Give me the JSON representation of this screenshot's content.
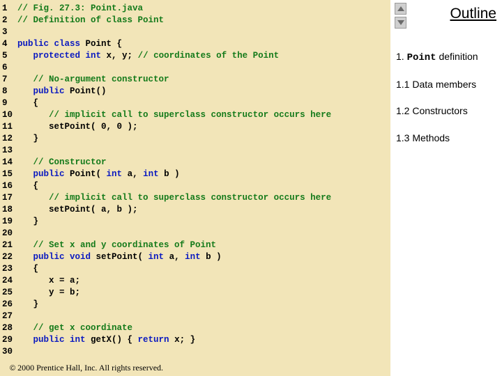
{
  "outline": {
    "title": "Outline",
    "items": [
      {
        "num": "1.",
        "label_mono": "Point",
        "label_rest": " definition"
      },
      {
        "num": "1.1",
        "label_rest": " Data members"
      },
      {
        "num": "1.2",
        "label_rest": " Constructors"
      },
      {
        "num": "1.3",
        "label_rest": " Methods"
      }
    ]
  },
  "footer": "  2000 Prentice Hall, Inc. All rights reserved.",
  "copyright_symbol": "©",
  "code_lines": [
    {
      "n": "1",
      "segs": [
        {
          "c": "cm",
          "t": "// Fig. 27.3: Point.java"
        }
      ]
    },
    {
      "n": "2",
      "segs": [
        {
          "c": "cm",
          "t": "// Definition of class Point"
        }
      ]
    },
    {
      "n": "3",
      "segs": []
    },
    {
      "n": "4",
      "segs": [
        {
          "c": "kw",
          "t": "public class "
        },
        {
          "t": "Point {"
        }
      ]
    },
    {
      "n": "5",
      "segs": [
        {
          "t": "   "
        },
        {
          "c": "kw",
          "t": "protected int "
        },
        {
          "t": "x, y; "
        },
        {
          "c": "cm",
          "t": "// coordinates of the Point"
        }
      ]
    },
    {
      "n": "6",
      "segs": []
    },
    {
      "n": "7",
      "segs": [
        {
          "t": "   "
        },
        {
          "c": "cm",
          "t": "// No-argument constructor"
        }
      ]
    },
    {
      "n": "8",
      "segs": [
        {
          "t": "   "
        },
        {
          "c": "kw",
          "t": "public "
        },
        {
          "t": "Point()"
        }
      ]
    },
    {
      "n": "9",
      "segs": [
        {
          "t": "   {"
        }
      ]
    },
    {
      "n": "10",
      "segs": [
        {
          "t": "      "
        },
        {
          "c": "cm",
          "t": "// implicit call to superclass constructor occurs here"
        }
      ]
    },
    {
      "n": "11",
      "segs": [
        {
          "t": "      setPoint( 0, 0 );"
        }
      ]
    },
    {
      "n": "12",
      "segs": [
        {
          "t": "   }"
        }
      ]
    },
    {
      "n": "13",
      "segs": []
    },
    {
      "n": "14",
      "segs": [
        {
          "t": "   "
        },
        {
          "c": "cm",
          "t": "// Constructor"
        }
      ]
    },
    {
      "n": "15",
      "segs": [
        {
          "t": "   "
        },
        {
          "c": "kw",
          "t": "public "
        },
        {
          "t": "Point( "
        },
        {
          "c": "kw",
          "t": "int "
        },
        {
          "t": "a, "
        },
        {
          "c": "kw",
          "t": "int "
        },
        {
          "t": "b )"
        }
      ]
    },
    {
      "n": "16",
      "segs": [
        {
          "t": "   {"
        }
      ]
    },
    {
      "n": "17",
      "segs": [
        {
          "t": "      "
        },
        {
          "c": "cm",
          "t": "// implicit call to superclass constructor occurs here"
        }
      ]
    },
    {
      "n": "18",
      "segs": [
        {
          "t": "      setPoint( a, b );"
        }
      ]
    },
    {
      "n": "19",
      "segs": [
        {
          "t": "   }"
        }
      ]
    },
    {
      "n": "20",
      "segs": []
    },
    {
      "n": "21",
      "segs": [
        {
          "t": "   "
        },
        {
          "c": "cm",
          "t": "// Set x and y coordinates of Point"
        }
      ]
    },
    {
      "n": "22",
      "segs": [
        {
          "t": "   "
        },
        {
          "c": "kw",
          "t": "public void "
        },
        {
          "t": "setPoint( "
        },
        {
          "c": "kw",
          "t": "int "
        },
        {
          "t": "a, "
        },
        {
          "c": "kw",
          "t": "int "
        },
        {
          "t": "b )"
        }
      ]
    },
    {
      "n": "23",
      "segs": [
        {
          "t": "   {"
        }
      ]
    },
    {
      "n": "24",
      "segs": [
        {
          "t": "      x = a;"
        }
      ]
    },
    {
      "n": "25",
      "segs": [
        {
          "t": "      y = b;"
        }
      ]
    },
    {
      "n": "26",
      "segs": [
        {
          "t": "   }"
        }
      ]
    },
    {
      "n": "27",
      "segs": []
    },
    {
      "n": "28",
      "segs": [
        {
          "t": "   "
        },
        {
          "c": "cm",
          "t": "// get x coordinate"
        }
      ]
    },
    {
      "n": "29",
      "segs": [
        {
          "t": "   "
        },
        {
          "c": "kw",
          "t": "public int "
        },
        {
          "t": "getX() { "
        },
        {
          "c": "kw",
          "t": "return "
        },
        {
          "t": "x; }"
        }
      ]
    },
    {
      "n": "30",
      "segs": []
    }
  ]
}
